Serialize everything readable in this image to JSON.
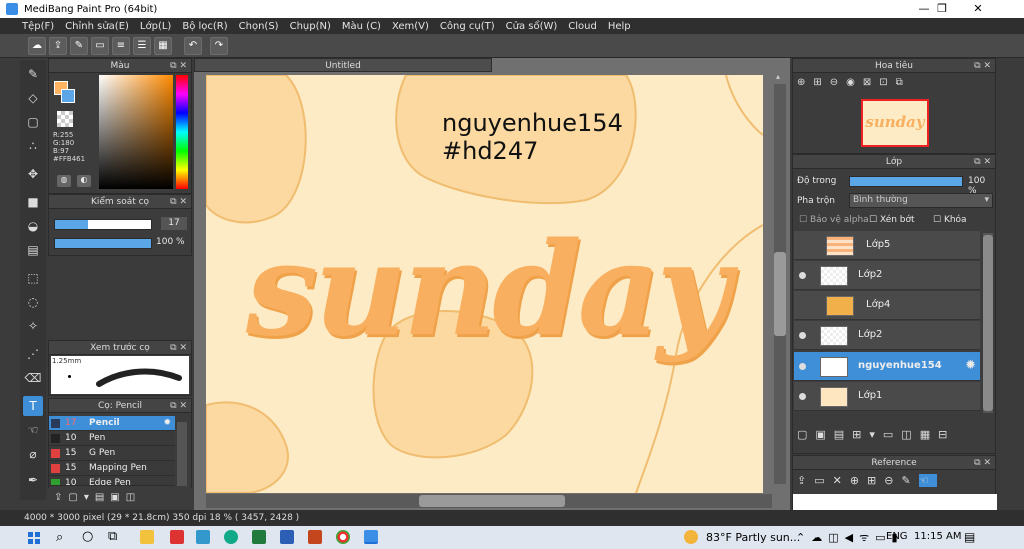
{
  "window": {
    "title": "MediBang Paint Pro (64bit)",
    "minimize": "—",
    "maximize": "❐",
    "close": "✕"
  },
  "menu": [
    "Tệp(F)",
    "Chỉnh sửa(E)",
    "Lớp(L)",
    "Bộ lọc(R)",
    "Chọn(S)",
    "Chụp(N)",
    "Màu (C)",
    "Xem(V)",
    "Công cụ(T)",
    "Cửa sổ(W)",
    "Cloud",
    "Help"
  ],
  "color_panel": {
    "title": "Màu",
    "r": "R:255",
    "g": "G:180",
    "b": "B:97",
    "hex": "#FFB461",
    "main_color": "#FFB461"
  },
  "brush_control": {
    "title": "Kiểm soát cọ",
    "size": "17",
    "opacity": "100 %"
  },
  "brush_preview": {
    "title": "Xem trước cọ",
    "size_label": "1.25mm"
  },
  "brush_list": {
    "title": "Cọ: Pencil",
    "items": [
      {
        "size": "17",
        "name": "Pencil",
        "color": "#ff4d4d"
      },
      {
        "size": "10",
        "name": "Pen",
        "color": "#222222"
      },
      {
        "size": "15",
        "name": "G Pen",
        "color": "#e04040"
      },
      {
        "size": "15",
        "name": "Mapping Pen",
        "color": "#e04040"
      },
      {
        "size": "10",
        "name": "Edge Pen",
        "color": "#30a030"
      }
    ]
  },
  "document": {
    "tab": "Untitled",
    "canvas_text_line1": "nguyenhue154",
    "canvas_text_line2": "#hd247",
    "lettering": "sunday"
  },
  "navigator": {
    "title": "Hoa tiêu"
  },
  "layer_panel": {
    "title": "Lớp",
    "opacity_label": "Độ trong",
    "opacity_value": "100 %",
    "blend_label": "Pha trộn",
    "blend_value": "Bình thường",
    "protect_alpha": "Bảo vệ alpha",
    "clipping": "Xén bớt",
    "lock": "Khóa",
    "layers": [
      {
        "name": "Lớp5",
        "selected": false
      },
      {
        "name": "Lớp2",
        "selected": false
      },
      {
        "name": "Lớp4",
        "selected": false
      },
      {
        "name": "Lớp2",
        "selected": false
      },
      {
        "name": "nguyenhue154",
        "selected": true
      },
      {
        "name": "Lớp1",
        "selected": false
      }
    ]
  },
  "reference": {
    "title": "Reference"
  },
  "status_bar": {
    "text": "4000 * 3000 pixel   (29 * 21.8cm)   350 dpi   18 %   ( 3457, 2428 )"
  },
  "taskbar": {
    "weather": "83°F  Partly sun...",
    "language": "ENG",
    "time": "11:15 AM"
  }
}
